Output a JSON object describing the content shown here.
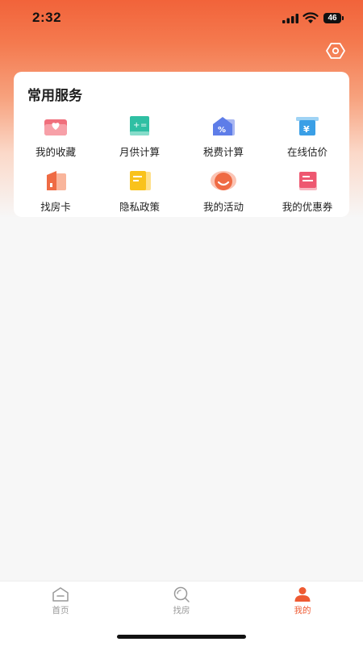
{
  "status_bar": {
    "time": "2:32",
    "battery": "46",
    "icons": [
      "signal-icon",
      "wifi-icon",
      "battery-icon"
    ]
  },
  "header": {
    "settings_icon": "settings-hexagon-icon"
  },
  "services": {
    "title": "常用服务",
    "items": [
      {
        "label": "我的收藏",
        "icon": "favorites-icon"
      },
      {
        "label": "月供计算",
        "icon": "monthly-payment-calculator-icon"
      },
      {
        "label": "税费计算",
        "icon": "tax-calculator-icon"
      },
      {
        "label": "在线估价",
        "icon": "online-valuation-icon"
      },
      {
        "label": "找房卡",
        "icon": "house-finder-card-icon"
      },
      {
        "label": "隐私政策",
        "icon": "privacy-policy-icon"
      },
      {
        "label": "我的活动",
        "icon": "my-activities-icon"
      },
      {
        "label": "我的优惠券",
        "icon": "my-coupons-icon"
      }
    ]
  },
  "tab_bar": {
    "tabs": [
      {
        "label": "首页",
        "icon": "home-icon",
        "active": false
      },
      {
        "label": "找房",
        "icon": "find-house-icon",
        "active": false
      },
      {
        "label": "我的",
        "icon": "profile-icon",
        "active": true
      }
    ]
  },
  "colors": {
    "accent": "#ee5a32",
    "header_gradient_top": "#f2633a",
    "page_background": "#f7f7f7"
  }
}
